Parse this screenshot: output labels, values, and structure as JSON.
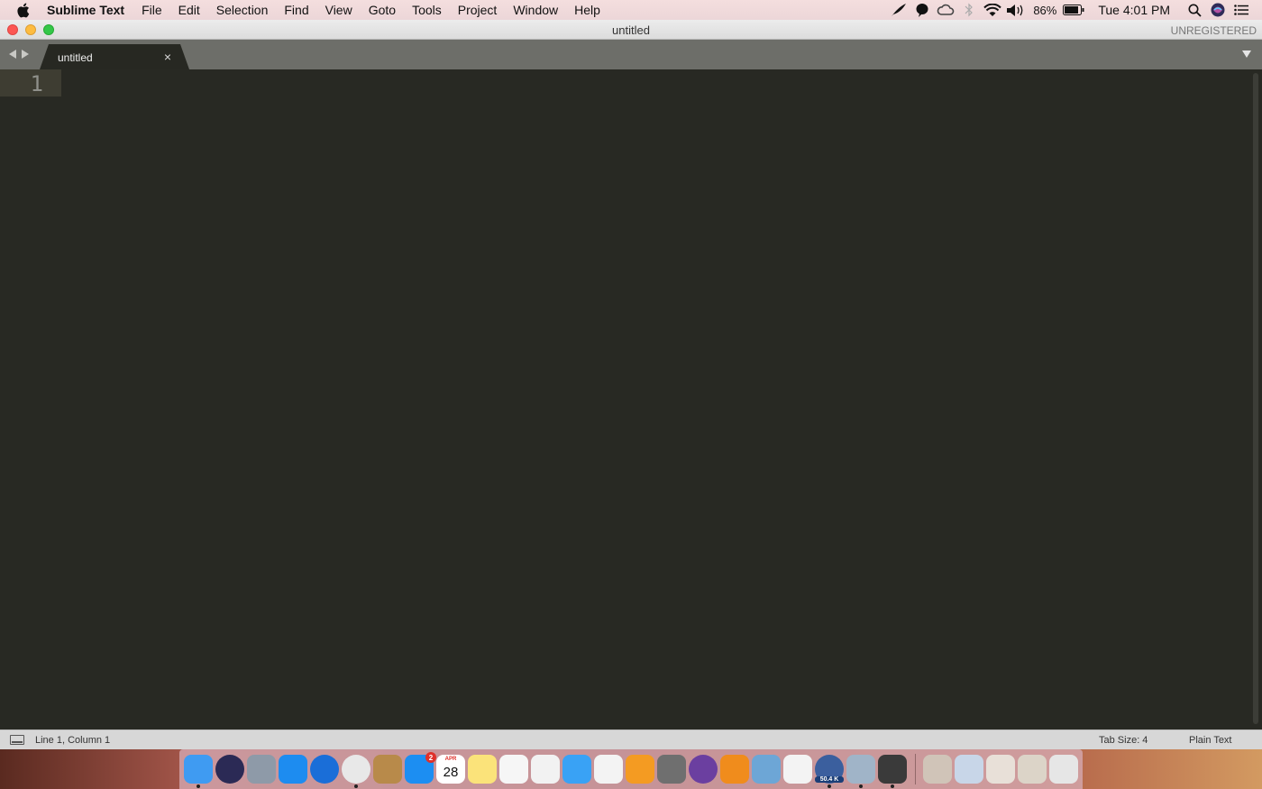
{
  "menubar": {
    "app_name": "Sublime Text",
    "menus": [
      "File",
      "Edit",
      "Selection",
      "Find",
      "View",
      "Goto",
      "Tools",
      "Project",
      "Window",
      "Help"
    ],
    "battery": "86%",
    "clock": "Tue 4:01 PM"
  },
  "window": {
    "title": "untitled",
    "registration": "UNREGISTERED"
  },
  "tabs": [
    {
      "label": "untitled",
      "close": "×"
    }
  ],
  "editor": {
    "line_numbers": [
      "1"
    ]
  },
  "statusbar": {
    "cursor_position": "Line 1, Column 1",
    "tab_size": "Tab Size: 4",
    "syntax": "Plain Text"
  },
  "dock": {
    "apps": [
      {
        "name": "Finder",
        "color": "#3f9bf2"
      },
      {
        "name": "Siri",
        "color": "#2b2a55"
      },
      {
        "name": "Launchpad",
        "color": "#8e9aa8"
      },
      {
        "name": "Safari",
        "color": "#1d8cf0"
      },
      {
        "name": "Firefox",
        "color": "#1a6ed8"
      },
      {
        "name": "Chrome",
        "color": "#e8e8e8"
      },
      {
        "name": "Notefile",
        "color": "#b88a4a"
      },
      {
        "name": "App Store",
        "color": "#1c8ef2",
        "badge": "2"
      },
      {
        "name": "Calendar",
        "color": "#ffffff",
        "month": "APR",
        "day": "28"
      },
      {
        "name": "Notes",
        "color": "#fbe37a"
      },
      {
        "name": "Reminders",
        "color": "#f6f6f6"
      },
      {
        "name": "Photos",
        "color": "#f2f2f2"
      },
      {
        "name": "Messages",
        "color": "#39a2f5"
      },
      {
        "name": "iTunes",
        "color": "#f3f3f3"
      },
      {
        "name": "Books",
        "color": "#f49b22"
      },
      {
        "name": "System Preferences",
        "color": "#6f6f6f"
      },
      {
        "name": "Tor Browser",
        "color": "#6b3fa0"
      },
      {
        "name": "VLC",
        "color": "#f08c1c"
      },
      {
        "name": "Preview",
        "color": "#6da6d6"
      },
      {
        "name": "TextEdit",
        "color": "#f3f3f3"
      },
      {
        "name": "Network Monitor",
        "color": "#3b5f9e",
        "label": "50.4 K"
      },
      {
        "name": "Utility",
        "color": "#a0b4c8"
      },
      {
        "name": "Sublime Text",
        "color": "#3a3a3a"
      }
    ],
    "stacks": [
      {
        "name": "Stack 1",
        "color": "#d0c4b8"
      },
      {
        "name": "Stack 2",
        "color": "#c8d6e8"
      },
      {
        "name": "Stack 3",
        "color": "#e8e0d8"
      },
      {
        "name": "Stack 4",
        "color": "#dcd4c8"
      },
      {
        "name": "Trash",
        "color": "#e6e6e6"
      }
    ]
  }
}
